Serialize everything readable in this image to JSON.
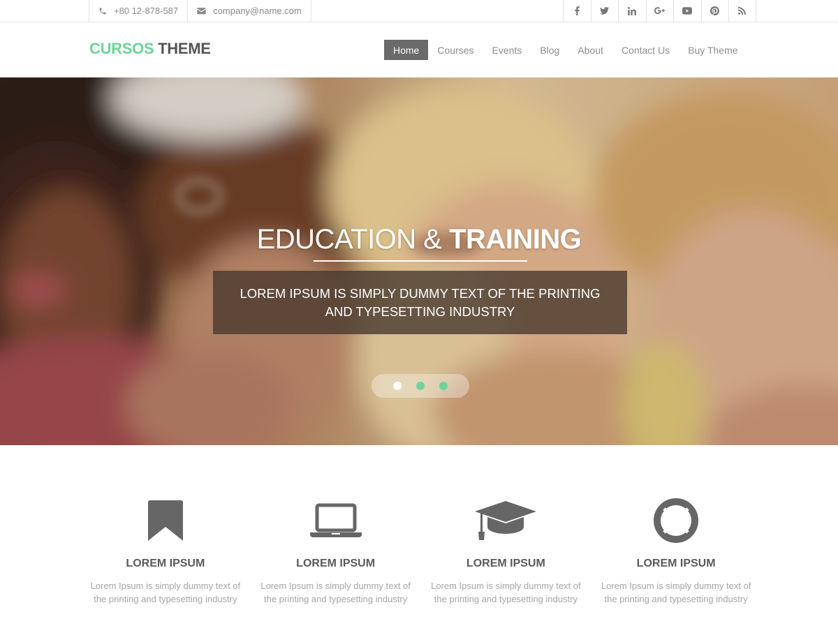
{
  "topbar": {
    "phone": "+80 12-878-587",
    "email": "company@name.com",
    "social": [
      {
        "icon": "facebook-icon"
      },
      {
        "icon": "twitter-icon"
      },
      {
        "icon": "linkedin-icon"
      },
      {
        "icon": "google-plus-icon"
      },
      {
        "icon": "youtube-icon"
      },
      {
        "icon": "pinterest-icon"
      },
      {
        "icon": "rss-icon"
      }
    ]
  },
  "header": {
    "logo_accent": "CURSOS",
    "logo_main": "THEME",
    "nav": [
      "Home",
      "Courses",
      "Events",
      "Blog",
      "About",
      "Contact Us",
      "Buy Theme"
    ],
    "active_nav": "Home"
  },
  "hero": {
    "title_light": "EDUCATION & ",
    "title_bold": "TRAINING",
    "caption": "LOREM IPSUM IS SIMPLY DUMMY TEXT OF THE PRINTING AND TYPESETTING INDUSTRY",
    "slides": [
      {
        "active": true
      },
      {
        "active": false
      },
      {
        "active": false
      }
    ]
  },
  "features": [
    {
      "icon": "bookmark-icon",
      "title": "LOREM IPSUM",
      "text": "Lorem Ipsum is simply dummy text of the printing and typesetting industry"
    },
    {
      "icon": "laptop-icon",
      "title": "LOREM IPSUM",
      "text": "Lorem Ipsum is simply dummy text of the printing and typesetting industry"
    },
    {
      "icon": "graduation-cap-icon",
      "title": "LOREM IPSUM",
      "text": "Lorem Ipsum is simply dummy text of the printing and typesetting industry"
    },
    {
      "icon": "life-ring-icon",
      "title": "LOREM IPSUM",
      "text": "Lorem Ipsum is simply dummy text of the printing and typesetting industry"
    }
  ],
  "colors": {
    "accent": "#6dd39b",
    "nav_active_bg": "#6a6a6a",
    "icon_gray": "#666666",
    "dot_active": "#ffffff",
    "dot_inactive": "#6dd39b"
  }
}
